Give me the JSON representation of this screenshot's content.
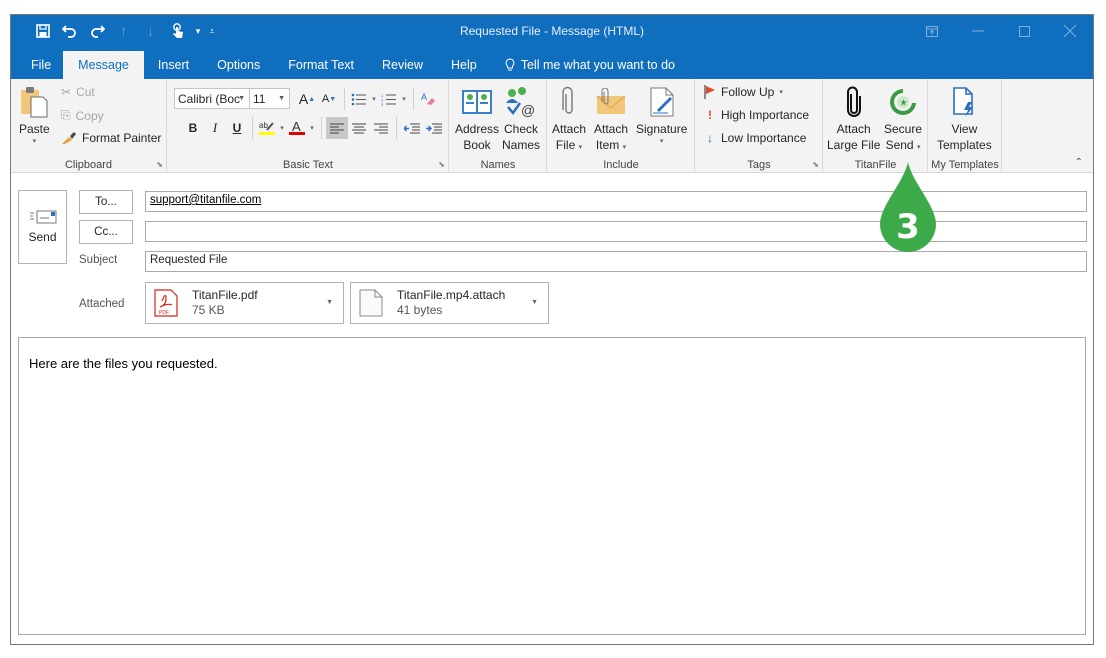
{
  "window": {
    "title": "Requested File  -  Message (HTML)",
    "controls": [
      {
        "name": "ribbon-display-options",
        "glyph": "⊡"
      },
      {
        "name": "minimize",
        "glyph": "—"
      },
      {
        "name": "maximize",
        "glyph": "☐"
      },
      {
        "name": "close",
        "glyph": "✕"
      }
    ]
  },
  "quick_access": [
    {
      "name": "save-icon",
      "glyph": "🖫"
    },
    {
      "name": "undo-icon",
      "glyph": "↶"
    },
    {
      "name": "redo-icon",
      "glyph": "↷"
    },
    {
      "name": "previous-item-icon",
      "glyph": "↑"
    },
    {
      "name": "next-item-icon",
      "glyph": "↓"
    },
    {
      "name": "touch-mode-icon",
      "glyph": "☝"
    }
  ],
  "tabs": [
    {
      "label": "File"
    },
    {
      "label": "Message",
      "active": true
    },
    {
      "label": "Insert"
    },
    {
      "label": "Options"
    },
    {
      "label": "Format Text"
    },
    {
      "label": "Review"
    },
    {
      "label": "Help"
    }
  ],
  "tell_me": "Tell me what you want to do",
  "ribbon": {
    "clipboard": {
      "label": "Clipboard",
      "paste": "Paste",
      "cut": "Cut",
      "copy": "Copy",
      "format_painter": "Format Painter"
    },
    "basic_text": {
      "label": "Basic Text",
      "font": "Calibri (Boc",
      "size": "11",
      "bold": "B",
      "italic": "I",
      "underline": "U"
    },
    "names": {
      "label": "Names",
      "address_book": [
        "Address",
        "Book"
      ],
      "check_names": [
        "Check",
        "Names"
      ]
    },
    "include": {
      "label": "Include",
      "attach_file": [
        "Attach",
        "File"
      ],
      "attach_item": [
        "Attach",
        "Item"
      ],
      "signature": "Signature"
    },
    "tags": {
      "label": "Tags",
      "follow_up": "Follow Up",
      "high_importance": "High Importance",
      "low_importance": "Low Importance"
    },
    "titanfile": {
      "label": "TitanFile",
      "attach_large": [
        "Attach",
        "Large File"
      ],
      "secure_send": [
        "Secure",
        "Send"
      ]
    },
    "my_templates": {
      "label": "My Templates",
      "view_templates": [
        "View",
        "Templates"
      ]
    }
  },
  "compose": {
    "send": "Send",
    "to_button": "To...",
    "cc_button": "Cc...",
    "to_value": "support@titanfile.com",
    "cc_value": "",
    "subject_label": "Subject",
    "subject_value": "Requested File",
    "attached_label": "Attached",
    "attachments": [
      {
        "name": "TitanFile.pdf",
        "size": "75 KB",
        "type": "pdf"
      },
      {
        "name": "TitanFile.mp4.attach",
        "size": "41 bytes",
        "type": "generic"
      }
    ],
    "body": "Here are the files you requested."
  },
  "callout": {
    "number": "3",
    "color": "#3daa4a"
  },
  "colors": {
    "titlebar": "#106ebe",
    "ribbon_bg": "#f3f3f3",
    "highlight_yellow": "#ffff00",
    "font_red": "#e00000"
  }
}
